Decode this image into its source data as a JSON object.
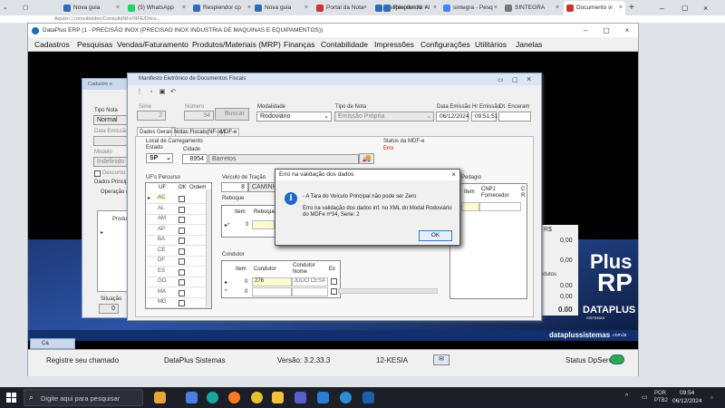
{
  "browser": {
    "tabs": [
      {
        "label": "Nova guia"
      },
      {
        "label": "(5) WhatsApp"
      },
      {
        "label": "Resplendor cp"
      },
      {
        "label": "Nova guia"
      },
      {
        "label": "Portal da Nota"
      },
      {
        "label": "Resplendor Al"
      },
      {
        "label": "Resplendor Al"
      },
      {
        "label": "sintegra - Pesq"
      },
      {
        "label": "SINTEGRA"
      },
      {
        "label": "Documento vi"
      }
    ],
    "address_fragment": "Aquivo | consulta/doc/ConsultaNFe/NFE/Docs..."
  },
  "app": {
    "title": "DataPlus ERP (1 - PRECISÃO INOX (PRECISAO INOX INDUSTRIA DE MAQUINAS E EQUIPAMENTOS))",
    "menu": [
      "Cadastros",
      "Pesquisas",
      "Vendas/Faturamento",
      "Produtos/Materiais (MRP)",
      "Finanças",
      "Contabilidade",
      "Impressões",
      "Configurações",
      "Utilitários",
      "Janelas"
    ],
    "brand": {
      "plus": "Plus",
      "rp": "RP",
      "dataplus": "DATAPLUS",
      "sistemas": "SISTEMAS",
      "site": "dataplussistemas",
      "site_tld": ".com.br"
    },
    "status": {
      "chamado": "Registre seu chamado",
      "sistema": "DataPlus Sistemas",
      "versao": "Versão: 3.2.33.3",
      "user": "12-KESIA",
      "server": "Status DpServer"
    }
  },
  "cadastro": {
    "title": "Cadastro e",
    "tipo_nota_label": "Tipo Nota",
    "tipo_nota_value": "Normal",
    "data_emissao_label": "Data Emissão",
    "modelo_label": "Modelo",
    "modelo_value": "Indefinido",
    "desconto_label": "Desconto",
    "dados_label": "Dados Princip",
    "operacao_label": "Operação d",
    "produto_label": "Produt",
    "situacao_label": "Situação",
    "situacao_value": "0",
    "task_label": "Ca"
  },
  "mdfe": {
    "title": "Manifesto Eletrônico de Documentos Fiscais",
    "serie_label": "Série",
    "serie_value": "2",
    "numero_label": "Número",
    "numero_value": "34",
    "buscar_label": "Buscar",
    "modalidade_label": "Modalidade",
    "modalidade_value": "Rodoviário",
    "tipo_nota_label": "Tipo de Nota",
    "tipo_nota_value": "Emissão Própria",
    "data_emissao_label": "Data Emissão",
    "data_emissao_value": "06/12/2024",
    "hr_emissao_label": "Hr Emissão",
    "hr_emissao_value": "09:51:51",
    "dt_encerr_label": "Dt. Enceram",
    "tabs": [
      "Dados Gerais",
      "Notas Fiscais(NF-e)",
      "MDF-e"
    ],
    "local_carreg_label": "Local de Carregamento",
    "estado_label": "Estado",
    "estado_value": "SP",
    "cidade_label": "Cidade",
    "cidade_code": "8954",
    "cidade_name": "Barretos",
    "status_label": "Status da MDF-e",
    "status_value": "Erro",
    "ufs_label": "UF's Percurso",
    "uf_headers": [
      "UF",
      "OK",
      "Ordem"
    ],
    "ufs": [
      "AC",
      "AL",
      "AM",
      "AP",
      "BA",
      "CE",
      "DF",
      "ES",
      "GO",
      "MA",
      "MG"
    ],
    "veiculo_label": "Veículo de Tração",
    "veiculo_code": "8",
    "veiculo_name": "CAMINHA",
    "reboque_label": "Reboque",
    "reboque_headers": [
      "Item",
      "Reboque"
    ],
    "reboque_item": "0",
    "pedagio_label": "Pedagio",
    "pedagio_headers": [
      "Item",
      "CNPJ Fornecedor",
      "C R"
    ],
    "condutor_label": "Condutor",
    "condutor_headers": [
      "Item",
      "Condutor",
      "Condutor Nome",
      "Ex"
    ],
    "condutor_rows": [
      {
        "item": "0",
        "cod": "276",
        "nome": "JULIO CESA"
      },
      {
        "item": "0",
        "cod": "",
        "nome": ""
      }
    ]
  },
  "right_panel": {
    "rs_label": "R$",
    "value1": "0,00",
    "value2": "0,00",
    "produtos_label": "odutos",
    "value3": "0,00",
    "value4": "0,00",
    "total": "0.00"
  },
  "dialog": {
    "title": "Erro na validação dos dados",
    "line1": "- A Tara do Veículo Principal não pode ser Zero",
    "line2": "Erro na validação dos dados inf. no XML do Modal Rodoviário do MDFe nº34, Serie: 2",
    "ok": "OK",
    "icon_glyph": "i"
  },
  "taskbar": {
    "search_placeholder": "Digite aqui para pesquisar",
    "lang": "POR",
    "layout": "PTB2",
    "time": "09:54",
    "date": "06/12/2024"
  }
}
